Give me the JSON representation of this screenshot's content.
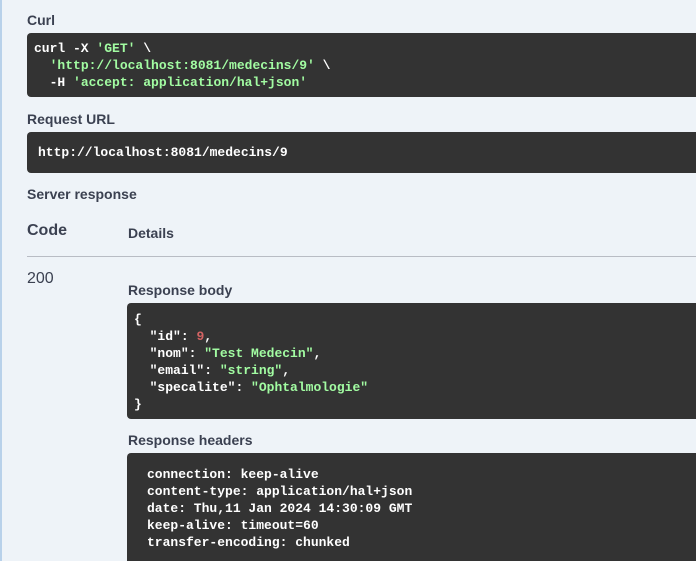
{
  "curl": {
    "label": "Curl",
    "line1_cmd": "curl -X ",
    "line1_method": "'GET'",
    "line1_cont": " \\",
    "line2_url": "'http://localhost:8081/medecins/9'",
    "line2_cont": " \\",
    "line3_flag": "-H ",
    "line3_header": "'accept: application/hal+json'"
  },
  "request_url": {
    "label": "Request URL",
    "value": "http://localhost:8081/medecins/9"
  },
  "server_response": {
    "label": "Server response",
    "code_header": "Code",
    "details_header": "Details",
    "status_code": "200",
    "body_label": "Response body",
    "body": {
      "open": "{",
      "close": "}",
      "fields": [
        {
          "key": "\"id\"",
          "value": "9",
          "type": "number",
          "trailing": ","
        },
        {
          "key": "\"nom\"",
          "value": "\"Test Medecin\"",
          "type": "string",
          "trailing": ","
        },
        {
          "key": "\"email\"",
          "value": "\"string\"",
          "type": "string",
          "trailing": ","
        },
        {
          "key": "\"specalite\"",
          "value": "\"Ophtalmologie\"",
          "type": "string",
          "trailing": ""
        }
      ]
    },
    "headers_label": "Response headers",
    "headers": [
      "connection: keep-alive",
      "content-type: application/hal+json",
      "date: Thu,11 Jan 2024 14:30:09 GMT",
      "keep-alive: timeout=60",
      "transfer-encoding: chunked"
    ]
  },
  "colors": {
    "page_bg": "#eef3f8",
    "code_bg": "#333333",
    "string": "#a2fca2",
    "number": "#d36363"
  }
}
